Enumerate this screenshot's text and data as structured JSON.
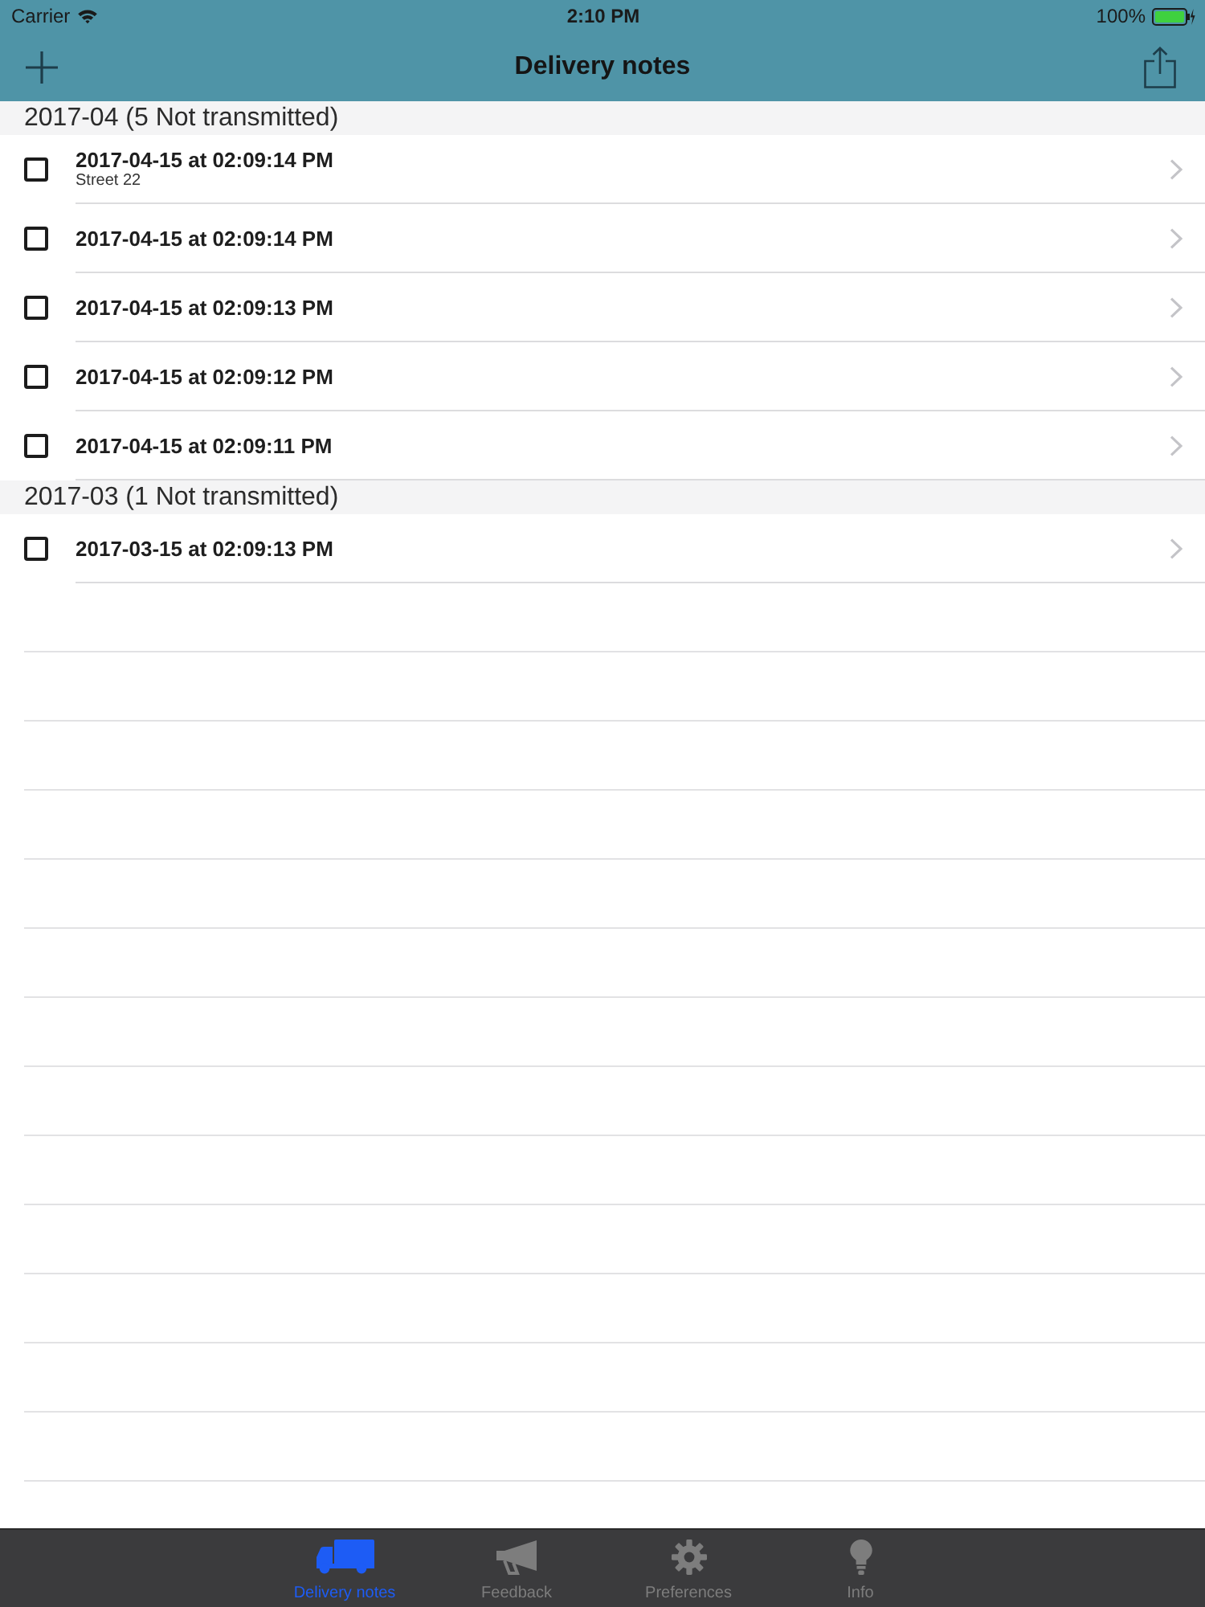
{
  "status_bar": {
    "carrier": "Carrier",
    "time": "2:10 PM",
    "battery": "100%"
  },
  "nav_bar": {
    "title": "Delivery notes"
  },
  "sections": [
    {
      "title": "2017-04 (5 Not transmitted)",
      "rows": [
        {
          "title": "2017-04-15 at 02:09:14 PM",
          "subtitle": "Street 22",
          "checked": false
        },
        {
          "title": "2017-04-15 at 02:09:14 PM",
          "checked": false
        },
        {
          "title": "2017-04-15 at 02:09:13 PM",
          "checked": false
        },
        {
          "title": "2017-04-15 at 02:09:12 PM",
          "checked": false
        },
        {
          "title": "2017-04-15 at 02:09:11 PM",
          "checked": false
        }
      ]
    },
    {
      "title": "2017-03 (1 Not transmitted)",
      "rows": [
        {
          "title": "2017-03-15 at 02:09:13 PM",
          "checked": false
        }
      ]
    }
  ],
  "tab_bar": [
    {
      "label": "Delivery notes",
      "selected": true
    },
    {
      "label": "Feedback",
      "selected": false
    },
    {
      "label": "Preferences",
      "selected": false
    },
    {
      "label": "Info",
      "selected": false
    }
  ]
}
